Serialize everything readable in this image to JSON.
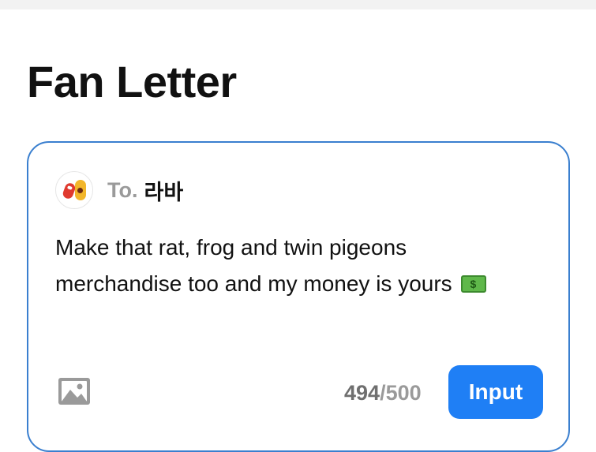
{
  "page": {
    "title": "Fan Letter"
  },
  "letter": {
    "to_label": "To.",
    "recipient": "라바",
    "message": "Make that rat, frog and twin pigeons merchandise too and my money is yours",
    "message_emoji_icon": "money-bill-icon",
    "char_count": "494",
    "char_separator": "/",
    "char_max": "500",
    "submit_label": "Input"
  },
  "colors": {
    "accent": "#1f7ff5",
    "card_border": "#3a7fcf",
    "muted_text": "#9a9a9a"
  }
}
